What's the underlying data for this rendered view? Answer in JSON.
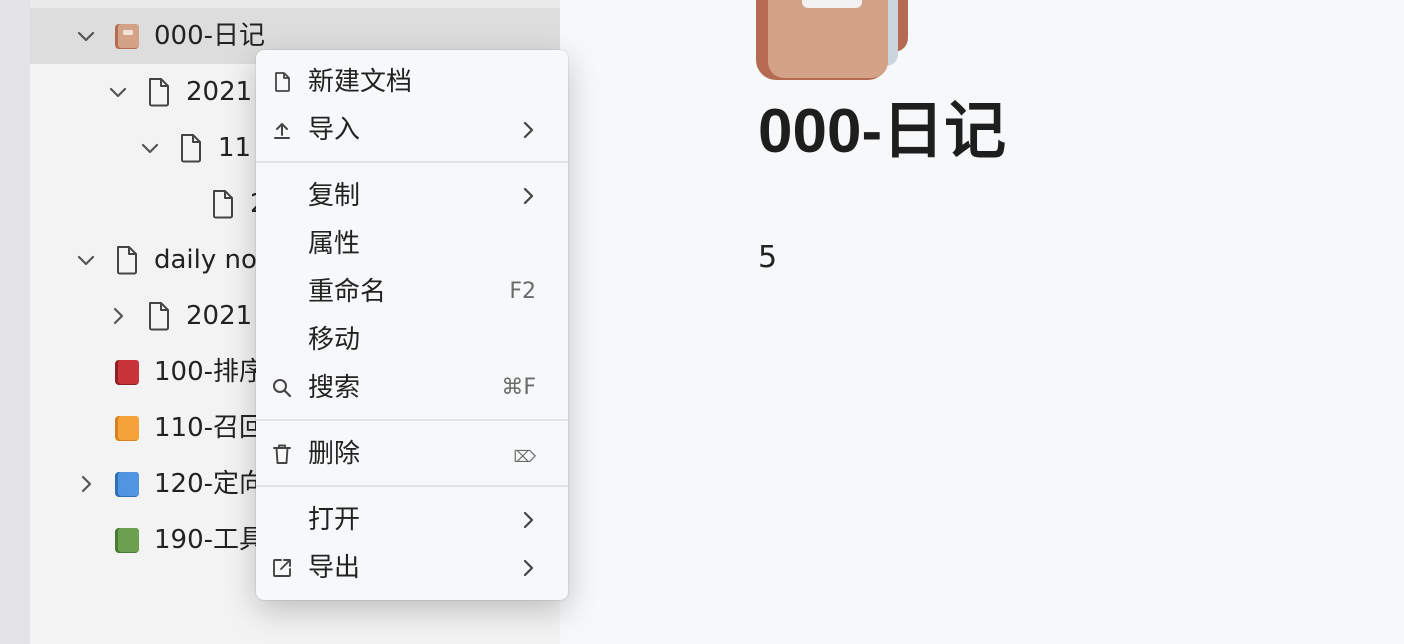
{
  "sidebar": {
    "items": [
      {
        "label": "000-日记",
        "icon": "diary-book-icon",
        "expanded": true,
        "selected": true
      },
      {
        "label": "2021",
        "icon": "document-icon",
        "expanded": true
      },
      {
        "label": "11",
        "icon": "document-icon",
        "expanded": true
      },
      {
        "label": "2",
        "icon": "document-icon"
      },
      {
        "label": "daily not",
        "icon": "document-icon",
        "expanded": true
      },
      {
        "label": "2021",
        "icon": "document-icon",
        "expanded": false
      },
      {
        "label": "100-排序",
        "icon": "red-book-icon",
        "color": "#c9343b"
      },
      {
        "label": "110-召回",
        "icon": "orange-book-icon",
        "color": "#f4a23a"
      },
      {
        "label": "120-定向",
        "icon": "blue-book-icon",
        "color": "#4f95e0",
        "expanded": false
      },
      {
        "label": "190-工具",
        "icon": "green-book-icon",
        "color": "#6aa04e"
      }
    ]
  },
  "context_menu": {
    "items": [
      {
        "label": "新建文档",
        "icon": "new-document-icon"
      },
      {
        "label": "导入",
        "icon": "import-icon",
        "submenu": true
      },
      {
        "label": "复制",
        "submenu": true
      },
      {
        "label": "属性"
      },
      {
        "label": "重命名",
        "shortcut": "F2"
      },
      {
        "label": "移动"
      },
      {
        "label": "搜索",
        "icon": "search-icon",
        "shortcut": "⌘F"
      },
      {
        "label": "删除",
        "icon": "trash-icon",
        "shortcut": "⌦"
      },
      {
        "label": "打开",
        "submenu": true
      },
      {
        "label": "导出",
        "icon": "export-icon",
        "submenu": true
      }
    ]
  },
  "main": {
    "title": "000-日记",
    "content": "5",
    "icon": "diary-book-icon"
  },
  "colors": {
    "diary_book": "#d4a286",
    "selection": "#dddddd",
    "sidebar_bg": "#f3f3f3",
    "menu_bg": "#f7f8fa"
  }
}
